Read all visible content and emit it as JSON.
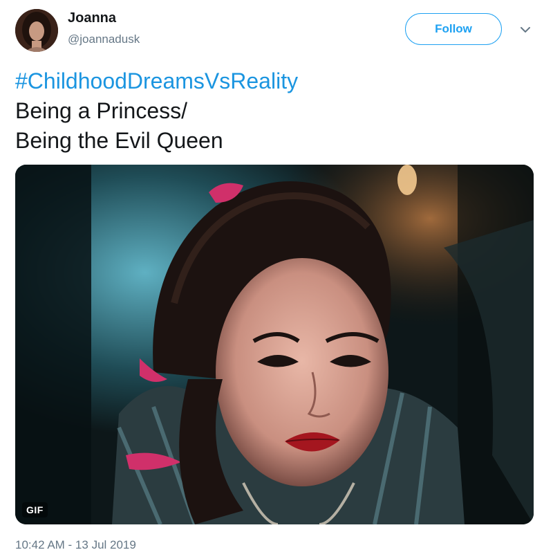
{
  "user": {
    "display_name": "Joanna",
    "handle": "@joannadusk"
  },
  "follow_button": {
    "label": "Follow"
  },
  "tweet": {
    "hashtag": "#ChildhoodDreamsVsReality",
    "lines": [
      "Being a Princess/",
      "Being the Evil Queen"
    ],
    "timestamp": "10:42 AM - 13 Jul 2019"
  },
  "media": {
    "badge": "GIF"
  },
  "colors": {
    "accent": "#1da1f2",
    "hashtag": "#1b95e0",
    "muted": "#657786",
    "text": "#14171a"
  },
  "icons": {
    "more": "chevron-down-icon"
  }
}
